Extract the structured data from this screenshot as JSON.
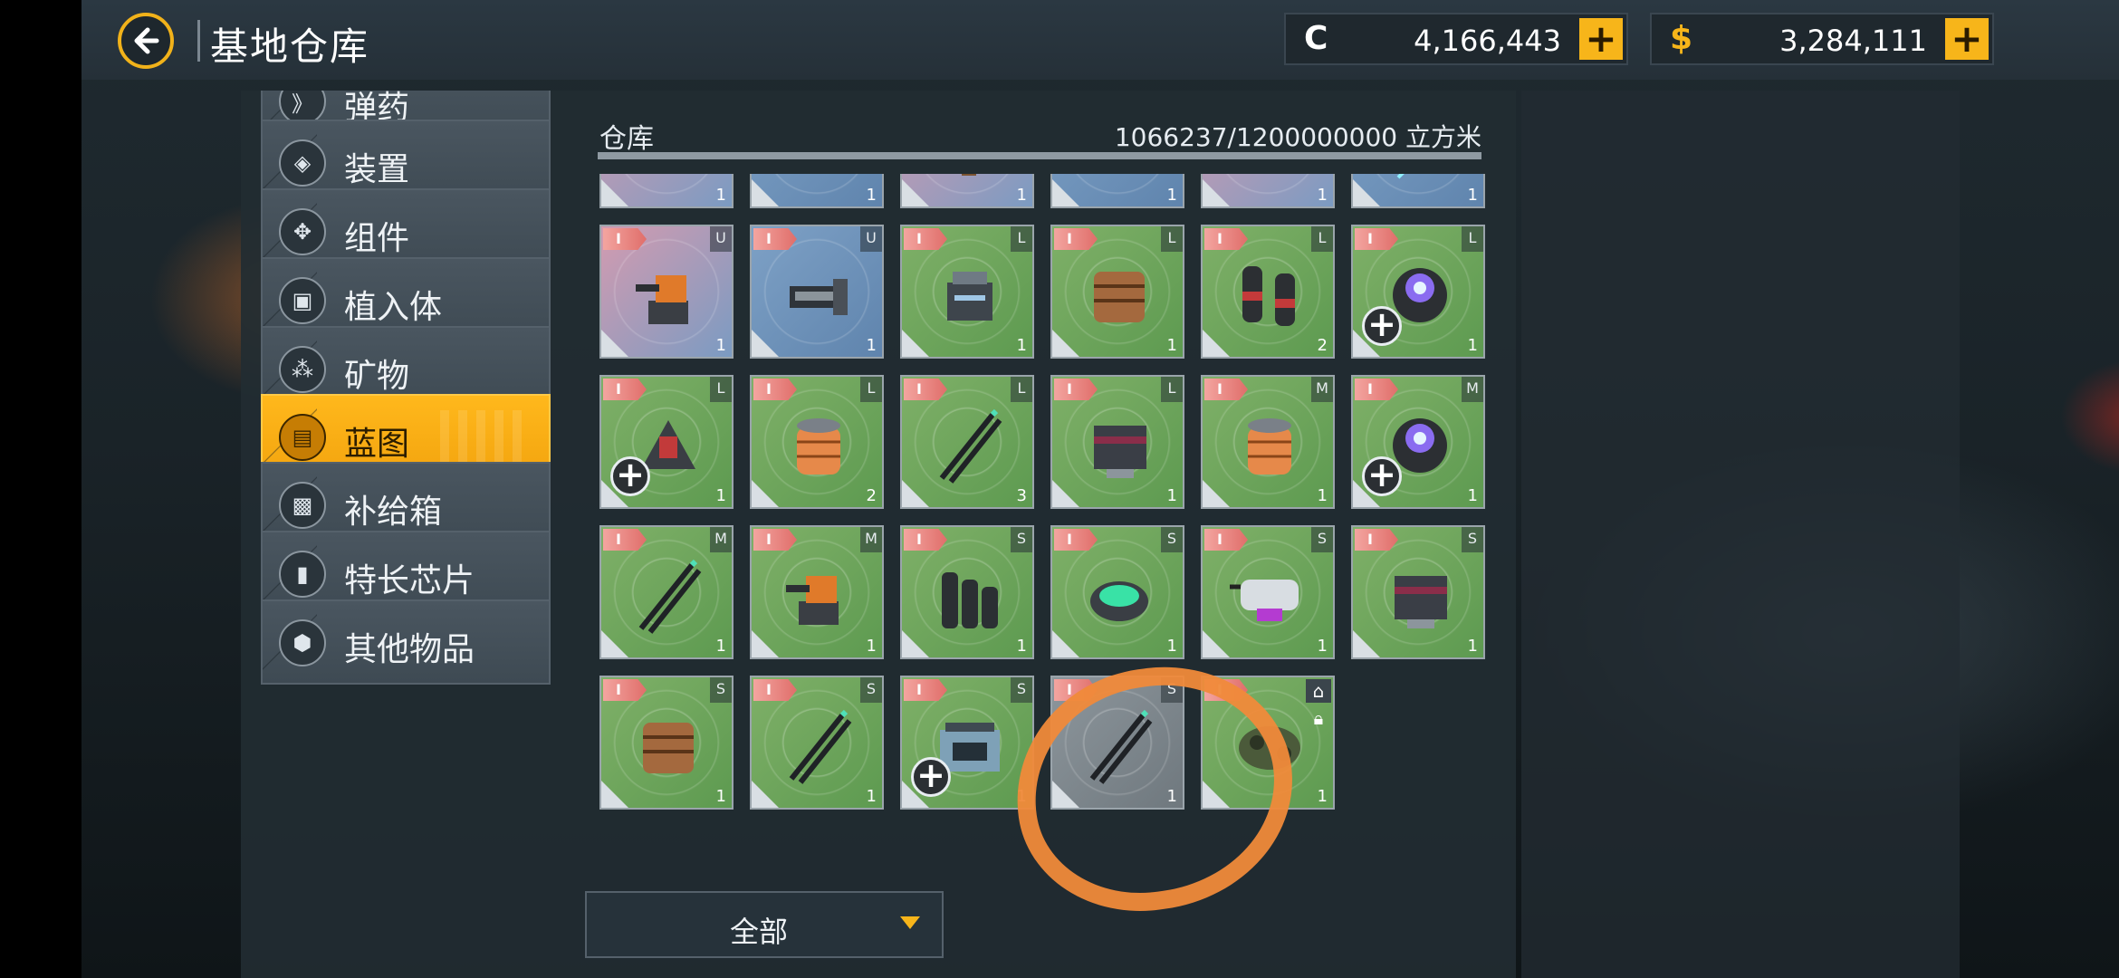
{
  "header": {
    "title": "基地仓库",
    "back_icon": "arrow-left-icon",
    "currencies": [
      {
        "symbol": "C",
        "value": "4,166,443",
        "plus": "+",
        "color": "#ffffff"
      },
      {
        "symbol": "$",
        "value": "3,284,111",
        "plus": "+",
        "color": "#f7b51a"
      }
    ]
  },
  "sidebar": {
    "items": [
      {
        "label": "弹药",
        "icon": "ammo-icon",
        "glyph": "》",
        "active": false
      },
      {
        "label": "装置",
        "icon": "device-icon",
        "glyph": "◈",
        "active": false
      },
      {
        "label": "组件",
        "icon": "component-icon",
        "glyph": "✥",
        "active": false
      },
      {
        "label": "植入体",
        "icon": "implant-icon",
        "glyph": "▣",
        "active": false
      },
      {
        "label": "矿物",
        "icon": "mineral-icon",
        "glyph": "⁂",
        "active": false
      },
      {
        "label": "蓝图",
        "icon": "blueprint-icon",
        "glyph": "▤",
        "active": true
      },
      {
        "label": "补给箱",
        "icon": "supply-box-icon",
        "glyph": "▩",
        "active": false
      },
      {
        "label": "特长芯片",
        "icon": "chip-icon",
        "glyph": "▮",
        "active": false
      },
      {
        "label": "其他物品",
        "icon": "other-items-icon",
        "glyph": "⬢",
        "active": false
      }
    ]
  },
  "storage": {
    "title": "仓库",
    "capacity": "1066237/1200000000 立方米",
    "used_fraction": 0.001
  },
  "filter": {
    "label": "全部"
  },
  "tiers": {
    "roman": "I"
  },
  "tiles": [
    {
      "theme": "pink",
      "size": "",
      "count": "1",
      "plus": false,
      "art": "turret-icon"
    },
    {
      "theme": "blue",
      "size": "",
      "count": "1",
      "plus": false,
      "art": "cannon-icon"
    },
    {
      "theme": "pink",
      "size": "",
      "count": "1",
      "plus": false,
      "art": "laser-icon"
    },
    {
      "theme": "blue",
      "size": "",
      "count": "1",
      "plus": false,
      "art": "mount-icon"
    },
    {
      "theme": "pink",
      "size": "",
      "count": "1",
      "plus": false,
      "art": "beam-icon"
    },
    {
      "theme": "blue",
      "size": "",
      "count": "1",
      "plus": false,
      "art": "emitter-icon"
    },
    {
      "theme": "pink",
      "size": "U",
      "count": "1",
      "plus": false,
      "art": "turret-icon"
    },
    {
      "theme": "blue",
      "size": "U",
      "count": "1",
      "plus": false,
      "art": "cannon-icon"
    },
    {
      "theme": "green",
      "size": "L",
      "count": "1",
      "plus": false,
      "art": "generator-icon"
    },
    {
      "theme": "green",
      "size": "L",
      "count": "1",
      "plus": false,
      "art": "armor-plate-icon"
    },
    {
      "theme": "green",
      "size": "L",
      "count": "2",
      "plus": false,
      "art": "canister-icon"
    },
    {
      "theme": "green",
      "size": "L",
      "count": "1",
      "plus": true,
      "art": "reactor-icon"
    },
    {
      "theme": "green",
      "size": "L",
      "count": "1",
      "plus": true,
      "art": "launcher-icon"
    },
    {
      "theme": "green",
      "size": "L",
      "count": "2",
      "plus": false,
      "art": "coil-icon"
    },
    {
      "theme": "green",
      "size": "L",
      "count": "3",
      "plus": false,
      "art": "rods-icon"
    },
    {
      "theme": "green",
      "size": "L",
      "count": "1",
      "plus": false,
      "art": "block-icon"
    },
    {
      "theme": "green",
      "size": "M",
      "count": "1",
      "plus": false,
      "art": "coil-icon"
    },
    {
      "theme": "green",
      "size": "M",
      "count": "1",
      "plus": true,
      "art": "reactor-icon"
    },
    {
      "theme": "green",
      "size": "M",
      "count": "1",
      "plus": false,
      "art": "rods-icon"
    },
    {
      "theme": "green",
      "size": "M",
      "count": "1",
      "plus": false,
      "art": "turret-icon"
    },
    {
      "theme": "green",
      "size": "S",
      "count": "1",
      "plus": false,
      "art": "cells-icon"
    },
    {
      "theme": "green",
      "size": "S",
      "count": "1",
      "plus": false,
      "art": "disc-icon"
    },
    {
      "theme": "green",
      "size": "S",
      "count": "1",
      "plus": false,
      "art": "gatling-icon"
    },
    {
      "theme": "green",
      "size": "S",
      "count": "1",
      "plus": false,
      "art": "block-icon"
    },
    {
      "theme": "green",
      "size": "S",
      "count": "1",
      "plus": false,
      "art": "armor-plate-icon"
    },
    {
      "theme": "green",
      "size": "S",
      "count": "1",
      "plus": false,
      "art": "rods-icon"
    },
    {
      "theme": "green",
      "size": "S",
      "count": "1",
      "plus": true,
      "art": "module-icon"
    },
    {
      "theme": "gray",
      "size": "S",
      "count": "1",
      "plus": false,
      "art": "rods-icon"
    },
    {
      "theme": "green",
      "size": "",
      "count": "1",
      "plus": false,
      "art": "drone-icon",
      "locked": true
    }
  ]
}
